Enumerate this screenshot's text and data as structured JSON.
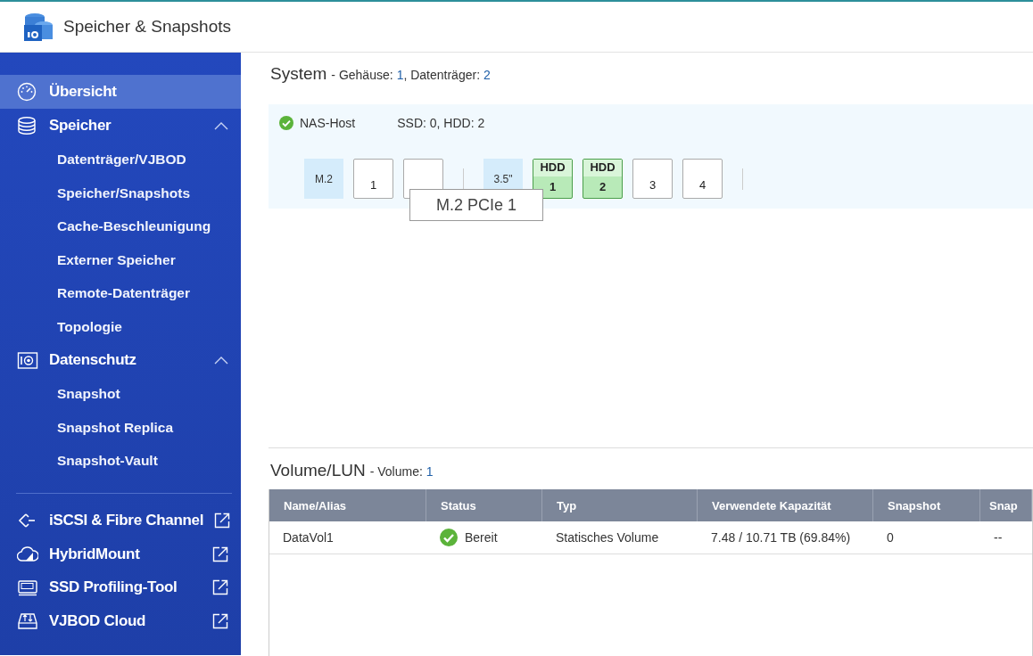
{
  "app": {
    "title": "Speicher & Snapshots"
  },
  "sidebar": {
    "items": [
      {
        "label": "Übersicht",
        "selected": true
      },
      {
        "label": "Speicher",
        "selected": false,
        "expanded": true,
        "children": [
          {
            "label": "Datenträger/VJBOD",
            "selected": false
          },
          {
            "label": "Speicher/Snapshots",
            "selected": false
          },
          {
            "label": "Cache-Beschleunigung",
            "selected": false
          },
          {
            "label": "Externer Speicher",
            "selected": false
          },
          {
            "label": "Remote-Datenträger",
            "selected": false
          },
          {
            "label": "Topologie",
            "selected": false
          }
        ]
      },
      {
        "label": "Datenschutz",
        "selected": false,
        "expanded": true,
        "children": [
          {
            "label": "Snapshot",
            "selected": false
          },
          {
            "label": "Snapshot Replica",
            "selected": false
          },
          {
            "label": "Snapshot-Vault",
            "selected": false
          }
        ]
      }
    ],
    "external": [
      {
        "label": "iSCSI & Fibre Channel"
      },
      {
        "label": "HybridMount"
      },
      {
        "label": "SSD Profiling-Tool"
      },
      {
        "label": "VJBOD Cloud"
      }
    ]
  },
  "system": {
    "title": "System",
    "summary_parts": [
      {
        "label": "- Gehäuse:",
        "value": "1"
      },
      {
        "label": ", Datenträger:",
        "value": "2"
      }
    ],
    "host": {
      "name": "NAS-Host",
      "disks": "SSD: 0, HDD: 2"
    },
    "groups": [
      {
        "type_label": "M.2",
        "slots": [
          {
            "kind": "empty",
            "label": "1"
          },
          {
            "kind": "empty"
          }
        ]
      },
      {
        "type_label": "3.5\"",
        "slots": [
          {
            "kind": "disk",
            "top": "HDD",
            "label": "1"
          },
          {
            "kind": "disk",
            "top": "HDD",
            "label": "2"
          },
          {
            "kind": "empty",
            "label": "3"
          },
          {
            "kind": "empty",
            "label": "4"
          }
        ]
      }
    ],
    "tooltip": "M.2 PCIe 1"
  },
  "volumes": {
    "title": "Volume/LUN",
    "summary_label": "- Volume:",
    "summary_value": "1",
    "columns": [
      "Name/Alias",
      "Status",
      "Typ",
      "Verwendete Kapazität",
      "Snapshot",
      "Snap"
    ],
    "rows": [
      {
        "cells": [
          "DataVol1",
          "Bereit",
          "Statisches Volume",
          "7.48 / 10.71 TB (69.84%)",
          "0",
          "--"
        ],
        "status_ok": true
      }
    ]
  }
}
